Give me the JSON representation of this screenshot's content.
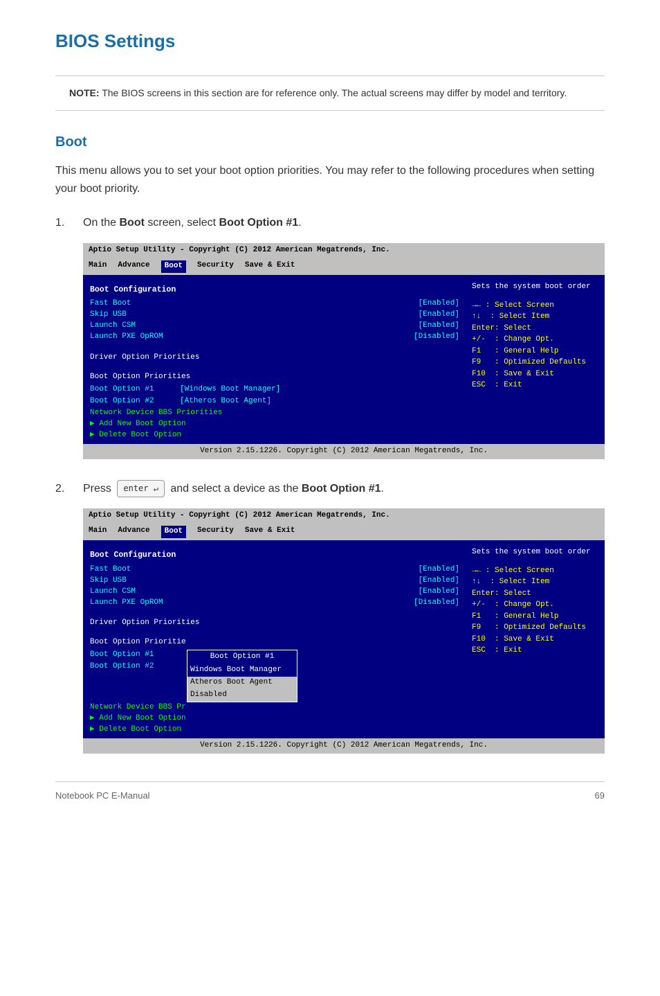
{
  "page": {
    "title": "BIOS Settings",
    "footer_text": "Notebook PC E-Manual",
    "footer_page": "69"
  },
  "note": {
    "prefix": "NOTE:",
    "text": " The BIOS screens in this section are for reference only. The actual screens may differ by model and territory."
  },
  "section": {
    "title": "Boot",
    "description": "This menu allows you to set your boot option priorities. You may refer to the following procedures when setting your boot priority."
  },
  "steps": [
    {
      "num": "1.",
      "text_before": "On the ",
      "bold1": "Boot",
      "text_mid": " screen, select ",
      "bold2": "Boot Option #1",
      "text_after": "."
    },
    {
      "num": "2.",
      "text_before": "Press ",
      "enter_key": "enter ↵",
      "text_after": " and select a device as the ",
      "bold2": "Boot Option #1",
      "period": "."
    }
  ],
  "bios1": {
    "titlebar": "Aptio Setup Utility - Copyright (C) 2012 American Megatrends, Inc.",
    "tabs": [
      "Main",
      "Advance",
      "Boot",
      "Security",
      "Save & Exit"
    ],
    "active_tab": "Boot",
    "section_header": "Boot Configuration",
    "items": [
      {
        "label": "Fast Boot",
        "value": "[Enabled]"
      },
      {
        "label": "Skip USB",
        "value": "[Enabled]"
      },
      {
        "label": "Launch CSM",
        "value": "[Enabled]"
      },
      {
        "label": "Launch PXE OpROM",
        "value": "[Disabled]"
      }
    ],
    "driver_section": "Driver Option Priorities",
    "boot_section": "Boot Option Priorities",
    "boot_items": [
      {
        "label": "Boot Option #1",
        "value": "[Windows Boot Manager]"
      },
      {
        "label": "Boot Option #2",
        "value": "[Atheros Boot Agent]"
      }
    ],
    "extra_items": [
      "Network Device BBS Priorities",
      "▶ Add New Boot Option",
      "▶ Delete Boot Option"
    ],
    "sidebar_desc": "Sets the system boot order",
    "hints": [
      "→← : Select Screen",
      "↑↓  : Select Item",
      "Enter: Select",
      "+/-  : Change Opt.",
      "F1   : General Help",
      "F9   : Optimized Defaults",
      "F10  : Save & Exit",
      "ESC  : Exit"
    ],
    "footer": "Version 2.15.1226. Copyright (C) 2012 American Megatrends, Inc."
  },
  "bios2": {
    "titlebar": "Aptio Setup Utility - Copyright (C) 2012 American Megatrends, Inc.",
    "tabs": [
      "Main",
      "Advance",
      "Boot",
      "Security",
      "Save & Exit"
    ],
    "active_tab": "Boot",
    "section_header": "Boot Configuration",
    "items": [
      {
        "label": "Fast Boot",
        "value": "[Enabled]"
      },
      {
        "label": "Skip USB",
        "value": "[Enabled]"
      },
      {
        "label": "Launch CSM",
        "value": "[Enabled]"
      },
      {
        "label": "Launch PXE OpROM",
        "value": "[Disabled]"
      }
    ],
    "driver_section": "Driver Option Priorities",
    "boot_section": "Boot Option Prioritie",
    "boot_items": [
      {
        "label": "Boot Option #1",
        "value": ""
      },
      {
        "label": "Boot Option #2",
        "value": ""
      }
    ],
    "extra_items": [
      "Network Device BBS Pr",
      "▶ Add New Boot Option",
      "▶ Delete Boot Option"
    ],
    "sidebar_desc": "Sets the system boot order",
    "hints": [
      "→← : Select Screen",
      "↑↓  : Select Item",
      "Enter: Select",
      "+/-  : Change Opt.",
      "F1   : General Help",
      "F9   : Optimized Defaults",
      "F10  : Save & Exit",
      "ESC  : Exit"
    ],
    "dropdown": {
      "title": "Boot Option #1",
      "options": [
        {
          "label": "Windows Boot Manager",
          "selected": false
        },
        {
          "label": "Atheros Boot Agent",
          "selected": false
        },
        {
          "label": "Disabled",
          "selected": false
        }
      ]
    },
    "footer": "Version 2.15.1226. Copyright (C) 2012 American Megatrends, Inc."
  }
}
